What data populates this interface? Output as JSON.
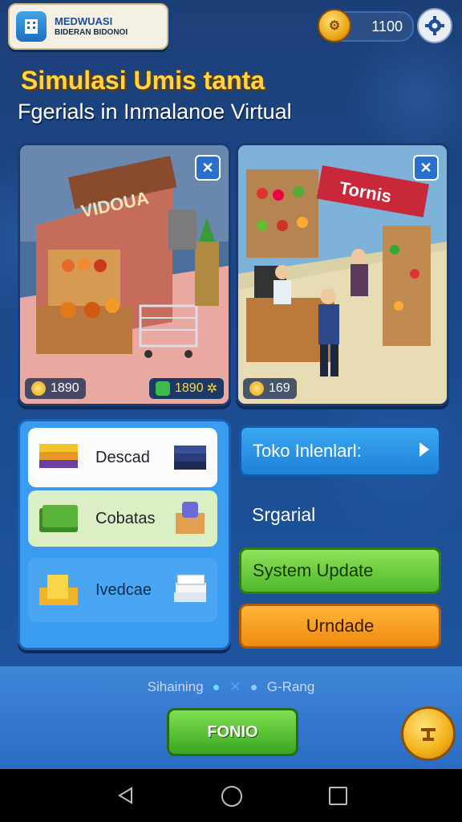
{
  "header": {
    "logo_title": "MEDWUASI",
    "logo_subtitle": "BIDERAN BIDONOI",
    "coins": "1100"
  },
  "titles": {
    "main": "Simulasi Umis tanta",
    "sub": "Fgerials in Inmalanoe Virtual"
  },
  "stores": [
    {
      "sign": "VIDOUA",
      "stat": "1890"
    },
    {
      "sign": "Tornis",
      "stat": "169"
    }
  ],
  "store_left_extra_stat": "1890",
  "inventory": [
    {
      "label": "Descad"
    },
    {
      "label": "Cobatas"
    },
    {
      "label": "Ivedcae"
    }
  ],
  "buttons": {
    "toko": "Toko Inlenlarl:",
    "plain": "Srgarial",
    "system": "System Update",
    "update": "Urndade",
    "main": "FONIO"
  },
  "pager": {
    "left": "Sihaining",
    "right": "G-Rang"
  },
  "colors": {
    "accent_yellow": "#ffd642",
    "green": "#4fb82a",
    "orange": "#f08a10",
    "blue": "#1f80d8"
  }
}
